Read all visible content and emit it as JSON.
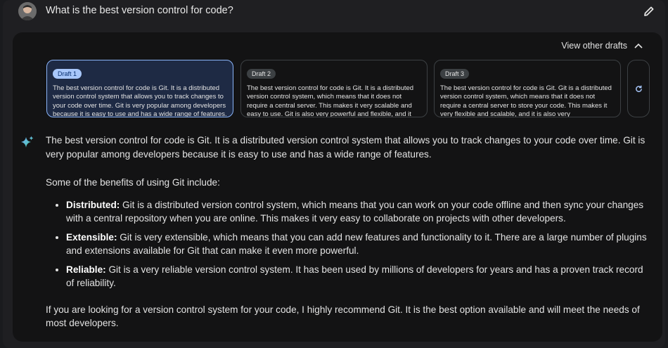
{
  "prompt": {
    "text": "What is the best version control for code?"
  },
  "drafts": {
    "toggle_label": "View other drafts",
    "items": [
      {
        "label": "Draft 1",
        "text": "The best version control for code is Git. It is a distributed version control system that allows you to track changes to your code over time. Git is very popular among developers because it is easy to use and has a wide range of features.",
        "selected": true
      },
      {
        "label": "Draft 2",
        "text": "The best version control for code is Git. It is a distributed version control system, which means that it does not require a central server. This makes it very scalable and easy to use. Git is also very powerful and flexible, and it",
        "selected": false
      },
      {
        "label": "Draft 3",
        "text": "The best version control for code is Git. Git is a distributed version control system, which means that it does not require a central server to store your code. This makes it very flexible and scalable, and it is also very",
        "selected": false
      }
    ]
  },
  "response": {
    "intro": "The best version control for code is Git. It is a distributed version control system that allows you to track changes to your code over time. Git is very popular among developers because it is easy to use and has a wide range of features.",
    "benefits_lead": "Some of the benefits of using Git include:",
    "benefits": [
      {
        "term": "Distributed:",
        "text": " Git is a distributed version control system, which means that you can work on your code offline and then sync your changes with a central repository when you are online. This makes it very easy to collaborate on projects with other developers."
      },
      {
        "term": "Extensible:",
        "text": " Git is very extensible, which means that you can add new features and functionality to it. There are a large number of plugins and extensions available for Git that can make it even more powerful."
      },
      {
        "term": "Reliable:",
        "text": " Git is a very reliable version control system. It has been used by millions of developers for years and has a proven track record of reliability."
      }
    ],
    "conclusion": "If you are looking for a version control system for your code, I highly recommend Git. It is the best option available and will meet the needs of most developers."
  },
  "icons": {
    "edit": "pencil-icon",
    "collapse": "chevron-up-icon",
    "regenerate": "refresh-icon",
    "assistant": "sparkle-icon"
  },
  "colors": {
    "background": "#131314",
    "selected_draft": "#1e2a44",
    "accent": "#a8c7fa",
    "sparkle": "#4a90e2"
  }
}
